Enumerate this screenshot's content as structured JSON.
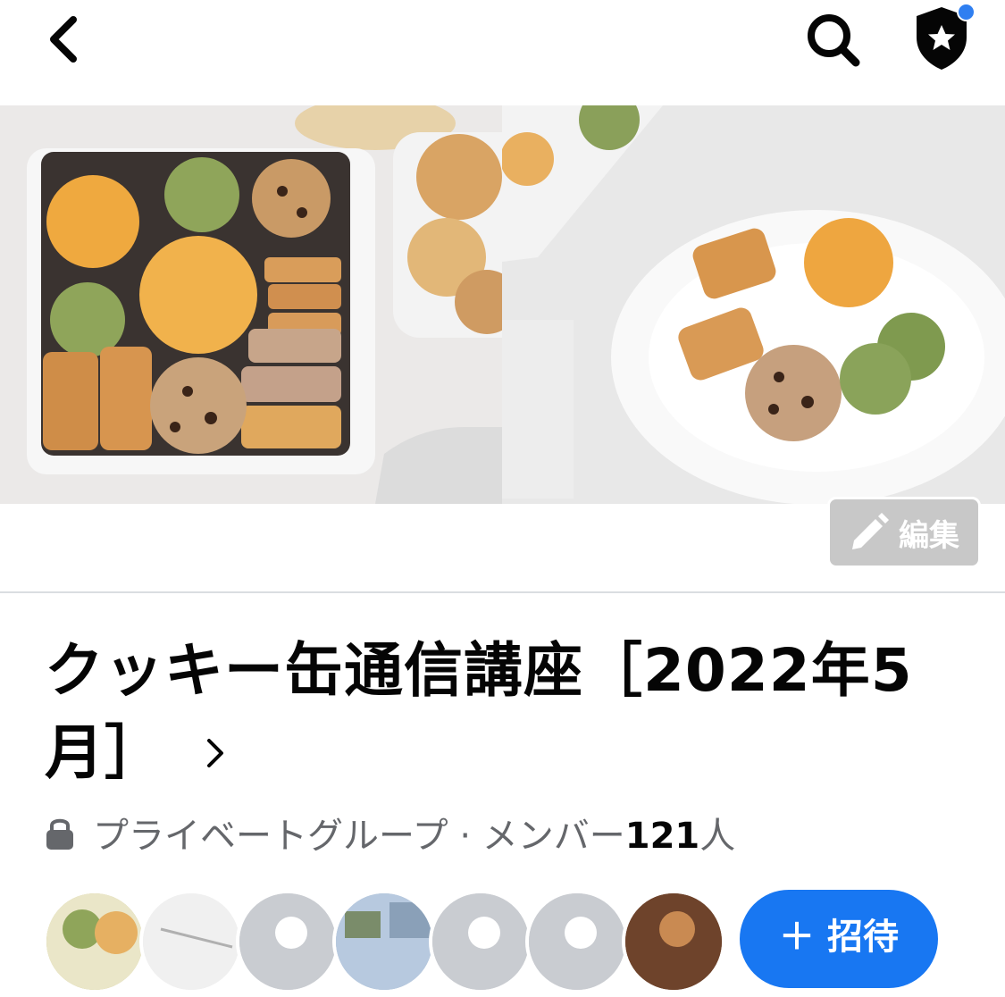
{
  "header": {
    "back_icon": "chevron-left-icon",
    "search_icon": "search-icon",
    "admin_icon": "shield-star-icon",
    "notification_dot_color": "#2f7ff1"
  },
  "cover": {
    "left_image": "cookie tin with assorted cookies",
    "right_image": "cookies on white plate",
    "edit_label": "編集",
    "edit_icon": "pencil-icon"
  },
  "group": {
    "title": "クッキー缶通信講座［2022年5月］",
    "privacy_icon": "lock-icon",
    "privacy_label": "プライベートグループ · メンバー",
    "member_count": "121",
    "member_unit": "人"
  },
  "members": {
    "invite_label": "＋ 招待",
    "accent_color": "#1877f2"
  }
}
